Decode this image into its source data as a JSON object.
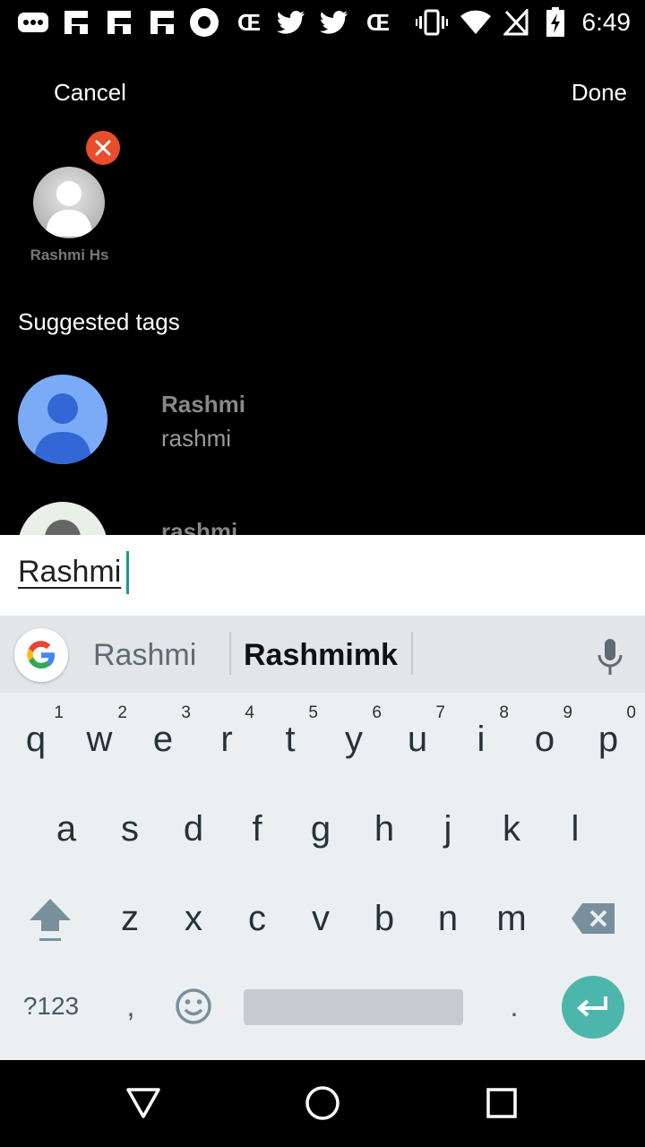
{
  "status_bar": {
    "time": "6:49",
    "icons": [
      "chat-icon",
      "flipboard-icon",
      "flipboard-icon",
      "flipboard-icon",
      "record-icon",
      "ce-icon",
      "twitter-icon",
      "twitter-icon",
      "ce-icon",
      "vibrate-icon",
      "wifi-icon",
      "no-sim-icon",
      "battery-charging-icon"
    ]
  },
  "header": {
    "cancel_label": "Cancel",
    "done_label": "Done"
  },
  "selected": {
    "name": "Rashmi Hs"
  },
  "suggested": {
    "title": "Suggested tags",
    "items": [
      {
        "name": "Rashmi",
        "username": "rashmi"
      },
      {
        "name": "rashmi",
        "username": ""
      }
    ]
  },
  "input": {
    "value": "Rashmi",
    "accent": "#1a9a8a"
  },
  "keyboard": {
    "suggestions": [
      "Rashmi",
      "Rashmimk"
    ],
    "row1": [
      {
        "k": "q",
        "n": "1"
      },
      {
        "k": "w",
        "n": "2"
      },
      {
        "k": "e",
        "n": "3"
      },
      {
        "k": "r",
        "n": "4"
      },
      {
        "k": "t",
        "n": "5"
      },
      {
        "k": "y",
        "n": "6"
      },
      {
        "k": "u",
        "n": "7"
      },
      {
        "k": "i",
        "n": "8"
      },
      {
        "k": "o",
        "n": "9"
      },
      {
        "k": "p",
        "n": "0"
      }
    ],
    "row2": [
      "a",
      "s",
      "d",
      "f",
      "g",
      "h",
      "j",
      "k",
      "l"
    ],
    "row3": [
      "z",
      "x",
      "c",
      "v",
      "b",
      "n",
      "m"
    ],
    "symbols_label": "?123",
    "comma": ",",
    "period": ".",
    "enter_color": "#4db6ac"
  },
  "nav": {
    "icons": [
      "back-icon",
      "home-icon",
      "recents-icon"
    ]
  }
}
